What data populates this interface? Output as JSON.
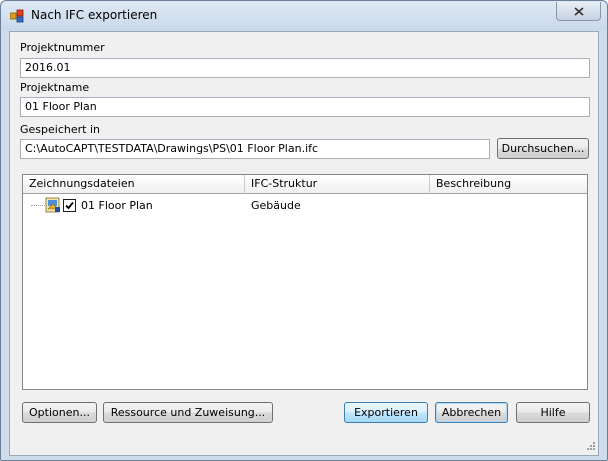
{
  "window": {
    "title": "Nach IFC exportieren"
  },
  "form": {
    "project_number_label": "Projektnummer",
    "project_number_value": "2016.01",
    "project_name_label": "Projektname",
    "project_name_value": "01 Floor Plan",
    "saved_in_label": "Gespeichert in",
    "saved_in_value": "C:\\AutoCAPT\\TESTDATA\\Drawings\\PS\\01 Floor Plan.ifc",
    "browse_label": "Durchsuchen..."
  },
  "table": {
    "columns": [
      "Zeichnungsdateien",
      "IFC-Struktur",
      "Beschreibung"
    ],
    "rows": [
      {
        "name": "01 Floor Plan",
        "structure": "Gebäude",
        "description": "",
        "checked": true
      }
    ]
  },
  "buttons": {
    "options": "Optionen...",
    "resources": "Ressource und Zuweisung...",
    "export": "Exportieren",
    "cancel": "Abbrechen",
    "help": "Hilfe"
  },
  "icons": {
    "app": "ifc-export-app-icon",
    "close": "close-x-icon",
    "file": "drawing-file-icon",
    "check": "checkmark-icon",
    "grip": "resize-grip-icon"
  }
}
